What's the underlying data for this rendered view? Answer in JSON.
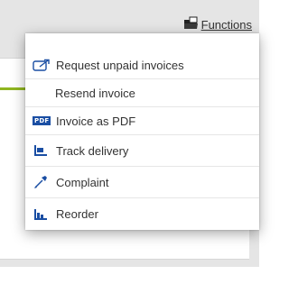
{
  "header": {
    "functions_label": "Functions",
    "functions_icon": "folder-icon"
  },
  "menu": {
    "items": [
      {
        "label": "Request unpaid invoices",
        "icon": "request-icon"
      },
      {
        "label": "Resend invoice",
        "icon": ""
      },
      {
        "label": "Invoice as PDF",
        "icon": "pdf-icon",
        "icon_text": "PDF"
      },
      {
        "label": "Track delivery",
        "icon": "track-delivery-icon"
      },
      {
        "label": "Complaint",
        "icon": "complaint-icon"
      },
      {
        "label": "Reorder",
        "icon": "reorder-icon"
      }
    ]
  },
  "colors": {
    "accent_green": "#8fb520",
    "icon_blue": "#1a4ea3"
  }
}
